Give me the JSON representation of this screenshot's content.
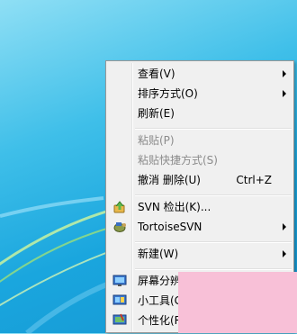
{
  "menu": {
    "items": [
      {
        "label": "查看(V)",
        "submenu": true
      },
      {
        "label": "排序方式(O)",
        "submenu": true
      },
      {
        "label": "刷新(E)"
      },
      {
        "label": "粘贴(P)",
        "disabled": true
      },
      {
        "label": "粘贴快捷方式(S)",
        "disabled": true
      },
      {
        "label": "撤消 删除(U)",
        "shortcut": "Ctrl+Z"
      },
      {
        "label": "SVN 检出(K)...",
        "icon": "svn-checkout-icon"
      },
      {
        "label": "TortoiseSVN",
        "icon": "tortoisesvn-icon",
        "submenu": true
      },
      {
        "label": "新建(W)",
        "submenu": true
      },
      {
        "label": "屏幕分辨率(C)",
        "icon": "screen-resolution-icon"
      },
      {
        "label": "小工具(G)",
        "icon": "gadgets-icon"
      },
      {
        "label": "个性化(R)",
        "icon": "personalize-icon"
      }
    ]
  },
  "colors": {
    "desktop": "#1aa6de",
    "menu_background": "#f0f0f0",
    "disabled_text": "#8b8b8b",
    "overlay": "#f8c0d7"
  }
}
